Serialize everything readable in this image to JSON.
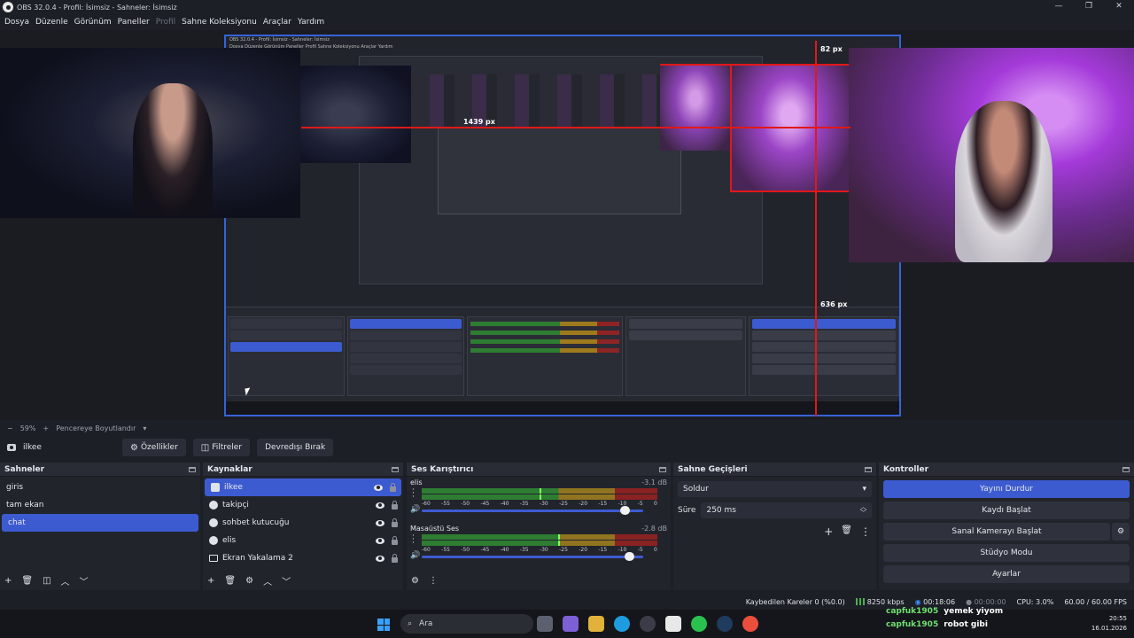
{
  "window": {
    "title": "OBS 32.0.4 - Profil: İsimsiz - Sahneler: İsimsiz",
    "controls": [
      "—",
      "❐",
      "✕"
    ]
  },
  "menu": [
    {
      "label": "Dosya",
      "disabled": false
    },
    {
      "label": "Düzenle",
      "disabled": false
    },
    {
      "label": "Görünüm",
      "disabled": false
    },
    {
      "label": "Paneller",
      "disabled": false
    },
    {
      "label": "Profil",
      "disabled": true
    },
    {
      "label": "Sahne Koleksiyonu",
      "disabled": false
    },
    {
      "label": "Araçlar",
      "disabled": false
    },
    {
      "label": "Yardım",
      "disabled": false
    }
  ],
  "preview": {
    "guides": [
      "82 px",
      "1439 px",
      "636 px"
    ],
    "nested_title": "OBS 32.0.4 - Profil: İsimsiz - Sahneler: İsimsiz",
    "nested_menu": "Dosya   Düzenle   Görünüm   Paneller   Profil   Sahne Koleksiyonu   Araçlar   Yardım"
  },
  "zoom": {
    "minus": "−",
    "value": "59%",
    "plus": "+",
    "mode": "Pencereye Boyutlandır",
    "caret": "▾"
  },
  "source_toolbar": {
    "source_name": "ilkee",
    "properties_label": "Özellikler",
    "filters_label": "Filtreler",
    "deactivate_label": "Devredışı Bırak"
  },
  "scenes": {
    "title": "Sahneler",
    "items": [
      "giris",
      "tam ekan",
      "chat"
    ],
    "selected": 2
  },
  "sources": {
    "title": "Kaynaklar",
    "items": [
      {
        "label": "ilkee",
        "icon": "camera-icon"
      },
      {
        "label": "takipçi",
        "icon": "browser-icon"
      },
      {
        "label": "sohbet kutucuğu",
        "icon": "browser-icon"
      },
      {
        "label": "elis",
        "icon": "browser-icon"
      },
      {
        "label": "Ekran Yakalama 2",
        "icon": "monitor-icon"
      }
    ],
    "selected": 0
  },
  "mixer": {
    "title": "Ses Karıştırıcı",
    "channels": [
      {
        "name": "elis",
        "db": "-3.1 dB",
        "volume": 0.92,
        "peak": 0.5
      },
      {
        "name": "Masaüstü Ses",
        "db": "-2.8 dB",
        "volume": 0.94,
        "peak": 0.58
      }
    ],
    "ticks": [
      "-60",
      "-55",
      "-50",
      "-45",
      "-40",
      "-35",
      "-30",
      "-25",
      "-20",
      "-15",
      "-10",
      "-5",
      "0"
    ]
  },
  "transitions": {
    "title": "Sahne Geçişleri",
    "selected": "Soldur",
    "duration_label": "Süre",
    "duration_value": "250 ms"
  },
  "controls": {
    "title": "Kontroller",
    "stop_stream": "Yayını Durdur",
    "start_record": "Kaydı Başlat",
    "virtual_cam": "Sanal Kamerayı Başlat",
    "studio_mode": "Stüdyo Modu",
    "settings": "Ayarlar"
  },
  "status": {
    "dropped": "Kaybedilen Kareler 0 (%0.0)",
    "bitrate": "8250 kbps",
    "live_time": "00:18:06",
    "rec_time": "00:00:00",
    "cpu": "CPU: 3.0%",
    "fps": "60.00 / 60.00 FPS"
  },
  "chat": [
    {
      "user": "capfuk1905",
      "msg": "yemek yiyom"
    },
    {
      "user": "capfuk1905",
      "msg": "robot gibi"
    }
  ],
  "taskbar": {
    "search_placeholder": "Ara",
    "time": "20:55",
    "date": "16.01.2026"
  },
  "colors": {
    "accent": "#3d5bd0",
    "guide": "#e01818",
    "chat_user": "#6fe06f"
  }
}
